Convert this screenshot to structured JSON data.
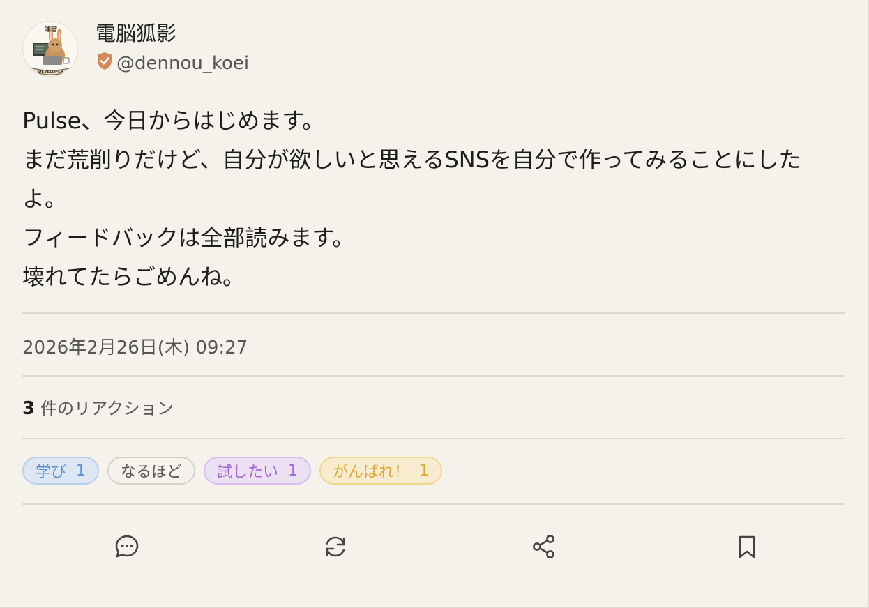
{
  "author": {
    "avatar_badge": "運営",
    "avatar_ribbon": "DEVELOPER",
    "display_name": "電脳狐影",
    "handle": "@dennou_koei",
    "verified_color": "#d48a5a"
  },
  "post": {
    "lines": [
      "Pulse、今日からはじめます。",
      "まだ荒削りだけど、自分が欲しいと思えるSNSを自分で作ってみることにした",
      "よ。",
      "フィードバックは全部読みます。",
      "壊れてたらごめんね。"
    ],
    "timestamp": "2026年2月26日(木) 09:27"
  },
  "reactions": {
    "count": "3",
    "count_label": "件のリアクション",
    "chips": [
      {
        "label": "学び",
        "count": "1",
        "color": "#5b8fd3"
      },
      {
        "label": "なるほど",
        "count": "",
        "color": "#555555"
      },
      {
        "label": "試したい",
        "count": "1",
        "color": "#a566d6"
      },
      {
        "label": "がんばれ！",
        "count": "1",
        "color": "#e2a830"
      }
    ]
  },
  "actions": [
    {
      "icon": "comment-icon"
    },
    {
      "icon": "repost-icon"
    },
    {
      "icon": "share-icon"
    },
    {
      "icon": "bookmark-icon"
    }
  ]
}
